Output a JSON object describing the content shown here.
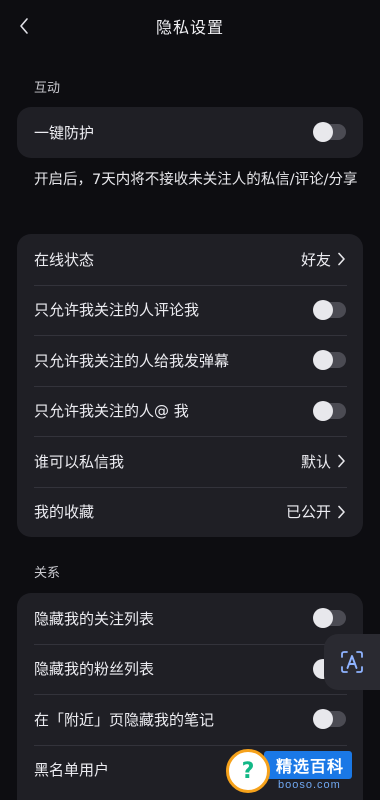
{
  "header": {
    "title": "隐私设置"
  },
  "interaction": {
    "section_label": "互动",
    "one_key_protect": {
      "label": "一键防护",
      "enabled": false
    },
    "description": "开启后，7天内将不接收未关注人的私信/评论/分享"
  },
  "privacy": {
    "items": [
      {
        "label": "在线状态",
        "value": "好友"
      },
      {
        "label": "只允许我关注的人评论我",
        "enabled": false
      },
      {
        "label": "只允许我关注的人给我发弹幕",
        "enabled": false
      },
      {
        "label": "只允许我关注的人@ 我",
        "enabled": false
      },
      {
        "label": "谁可以私信我",
        "value": "默认"
      },
      {
        "label": "我的收藏",
        "value": "已公开"
      }
    ]
  },
  "relationship": {
    "section_label": "关系",
    "items": [
      {
        "label": "隐藏我的关注列表",
        "enabled": false
      },
      {
        "label": "隐藏我的粉丝列表",
        "enabled": false
      },
      {
        "label": "在「附近」页隐藏我的笔记",
        "enabled": false
      },
      {
        "label": "黑名单用户"
      }
    ]
  },
  "watermark": {
    "title": "精选百科",
    "subtitle": "booso.com",
    "icon_glyph": "?"
  },
  "icons": {
    "back": "chevron-left-icon",
    "accessibility": "accessibility-a-icon"
  },
  "colors": {
    "background": "#0d0d11",
    "card": "#1f1f25",
    "toggle_off": "#4b4b53",
    "watermark_blue": "#1a78e6",
    "watermark_orange": "#f6a21b"
  }
}
